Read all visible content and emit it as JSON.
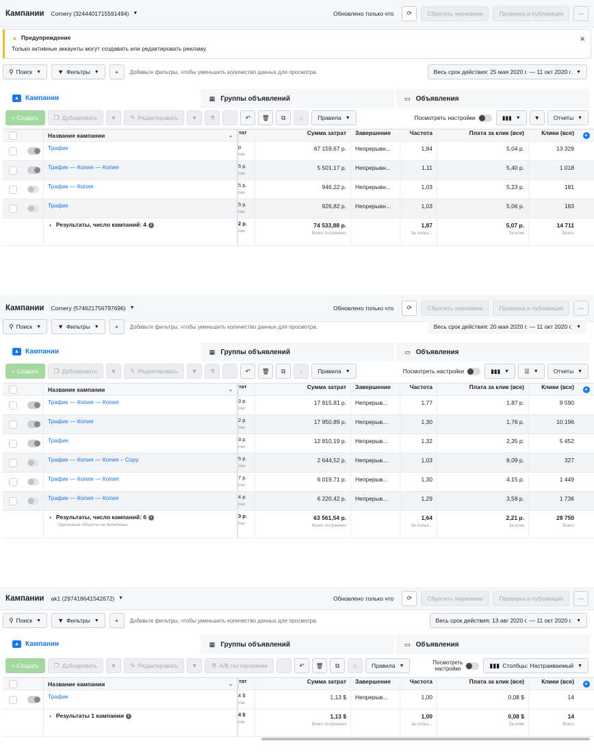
{
  "common": {
    "title": "Кампании",
    "updated": "Обновлено только что",
    "discard_drafts": "Сбросить черновики",
    "review_publish": "Проверка и публикация",
    "more": "···",
    "search": "Поиск",
    "filters": "Фильтры",
    "filters_hint": "Добавьте фильтры, чтобы уменьшить количество данных для просмотра.",
    "tab_campaigns": "Кампании",
    "tab_adsets": "Группы объявлений",
    "tab_ads": "Объявления",
    "create": "+ Создать",
    "duplicate": "Дублировать",
    "edit": "Редактировать",
    "ab_test": "A/B-тестирование",
    "rules": "Правила",
    "view_settings": "Посмотреть настройки",
    "view_settings_l1": "Посмотреть",
    "view_settings_l2": "настройки",
    "reports": "Отчеты",
    "columns_custom": "Столбцы: Настраиваемый",
    "headers": {
      "name": "Название кампании",
      "cut": "тат",
      "spend": "Сумма затрат",
      "end": "Завершение",
      "freq": "Частота",
      "cpc": "Плата за клик (все)",
      "clicks": "Клики (все)"
    },
    "sub_spent": "Всего потрачено",
    "sub_per_user": "За польз...",
    "sub_per_click": "За клик",
    "sub_total": "Всего",
    "sub_cut": "пке"
  },
  "warning": {
    "title": "Предупреждение",
    "body": "Только активные аккаунты могут создавать или редактировать рекламу."
  },
  "panel1": {
    "account": "Cornery (3244401715591494)",
    "date_range": "Весь срок действия: 25 мая 2020 г. — 11 окт 2020 г.",
    "rows": [
      {
        "name": "Трафик",
        "cut": "р.",
        "spend": "67 159,67 р.",
        "end": "Непрерывн...",
        "freq": "1,84",
        "cpc": "5,04 р.",
        "clicks": "13 329",
        "on": true
      },
      {
        "name": "Трафик — Копия — Копия",
        "cut": "5 р.",
        "spend": "5 501,17 р.",
        "end": "Непрерывн...",
        "freq": "1,11",
        "cpc": "5,40 р.",
        "clicks": "1 018",
        "on": true
      },
      {
        "name": "Трафик — Копия",
        "cut": "5 р.",
        "spend": "946,22 р.",
        "end": "Непрерывн...",
        "freq": "1,03",
        "cpc": "5,23 р.",
        "clicks": "181",
        "on": false
      },
      {
        "name": "Трафик",
        "cut": "5 р.",
        "spend": "926,82 р.",
        "end": "Непрерывн...",
        "freq": "1,03",
        "cpc": "5,06 р.",
        "clicks": "183",
        "on": false
      }
    ],
    "total": {
      "label": "Результаты, число кампаний: 4",
      "cut": "2 р.",
      "spend": "74 533,88 р.",
      "freq": "1,87",
      "cpc": "5,07 р.",
      "clicks": "14 711"
    }
  },
  "panel2": {
    "account": "Cornery (574621756797696)",
    "date_range": "Весь срок действия: 20 мая 2020 г. — 11 окт 2020 г.",
    "rows": [
      {
        "name": "Трафик — Копия — Копия",
        "cut": "3 р.",
        "spend": "17 915,81 р.",
        "end": "Непрерыв...",
        "freq": "1,77",
        "cpc": "1,87 р.",
        "clicks": "9 590",
        "on": true
      },
      {
        "name": "Трафик — Копия",
        "cut": "2 р.",
        "spend": "17 950,89 р.",
        "end": "Непрерыв...",
        "freq": "1,30",
        "cpc": "1,76 р.",
        "clicks": "10 196",
        "on": true
      },
      {
        "name": "Трафик",
        "cut": "3 р.",
        "spend": "12 810,19 р.",
        "end": "Непрерыв...",
        "freq": "1,32",
        "cpc": "2,35 р.",
        "clicks": "5 452",
        "on": true
      },
      {
        "name": "Трафик — Копия — Копия – Copy",
        "cut": "5 р.",
        "spend": "2 644,52 р.",
        "end": "Непрерыв...",
        "freq": "1,03",
        "cpc": "8,09 р.",
        "clicks": "327",
        "on": false
      },
      {
        "name": "Трафик — Копия — Копия",
        "cut": "7 р.",
        "spend": "6 019,71 р.",
        "end": "Непрерыв...",
        "freq": "1,30",
        "cpc": "4,15 р.",
        "clicks": "1 449",
        "on": false
      },
      {
        "name": "Трафик — Копия — Копия",
        "cut": "4 р.",
        "spend": "6 220,42 р.",
        "end": "Непрерыв...",
        "freq": "1,29",
        "cpc": "3,58 р.",
        "clicks": "1 736",
        "on": false
      }
    ],
    "total": {
      "label": "Результаты, число кампаний: 6",
      "note": "Удаленные объекты не включены",
      "cut": "3 р.",
      "spend": "63 561,54 р.",
      "freq": "1,64",
      "cpc": "2,21 р.",
      "clicks": "28 750"
    }
  },
  "panel3": {
    "account": "ak1 (297418641542672)",
    "date_range": "Весь срок действия: 13 авг 2020 г. — 11 окт 2020 г.",
    "rows": [
      {
        "name": "Трафик",
        "cut": "4 $",
        "spend": "1,13 $",
        "end": "Непрерыв...",
        "freq": "1,00",
        "cpc": "0,08 $",
        "clicks": "14",
        "on": true
      }
    ],
    "total": {
      "label": "Результаты 1 кампании",
      "cut": "4 $",
      "spend": "1,13 $",
      "freq": "1,00",
      "cpc": "0,08 $",
      "clicks": "14"
    }
  }
}
